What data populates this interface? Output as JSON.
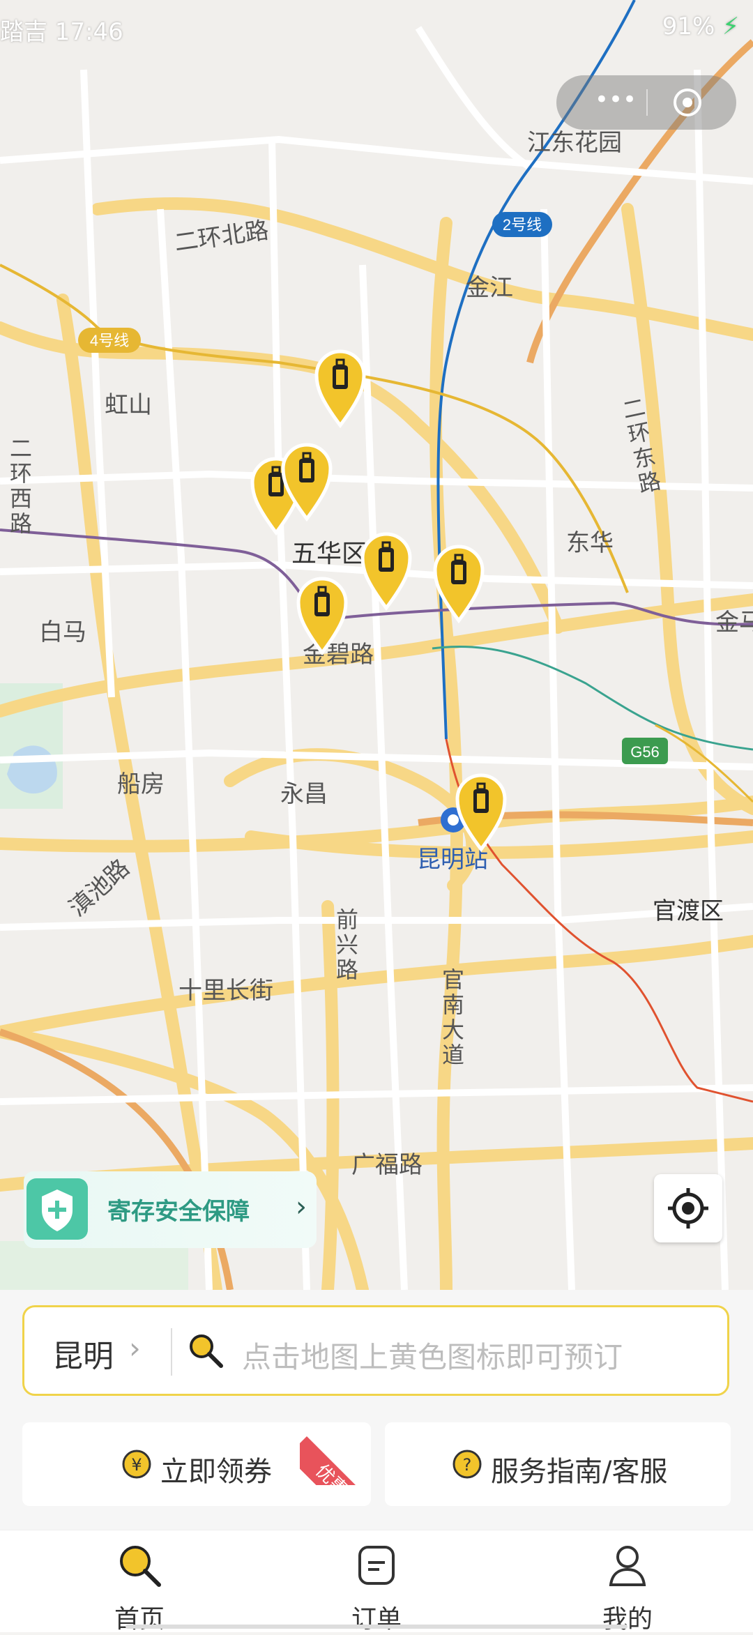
{
  "status_bar": {
    "left_text": "踏吉 17:46",
    "right_text": "91%"
  },
  "map": {
    "labels": [
      {
        "id": "jiangdong-huayuan",
        "text": "江东花园"
      },
      {
        "id": "line2",
        "text": "2号线"
      },
      {
        "id": "erhuan-beilu",
        "text": "二环北路"
      },
      {
        "id": "jinjiang",
        "text": "金江"
      },
      {
        "id": "line4",
        "text": "4号线"
      },
      {
        "id": "hongshan",
        "text": "虹山"
      },
      {
        "id": "erhuan-xilu",
        "text": "二环西路"
      },
      {
        "id": "erhuan-donglu",
        "text": "二环东路"
      },
      {
        "id": "wuhua-qu",
        "text": "五华区"
      },
      {
        "id": "donghua",
        "text": "东华"
      },
      {
        "id": "baima",
        "text": "白马"
      },
      {
        "id": "jinbi-lu",
        "text": "金碧路"
      },
      {
        "id": "chuanfang",
        "text": "船房"
      },
      {
        "id": "yongchang",
        "text": "永昌"
      },
      {
        "id": "kunming-zhan",
        "text": "昆明站"
      },
      {
        "id": "g56",
        "text": "G56"
      },
      {
        "id": "guandu-qu",
        "text": "官渡区"
      },
      {
        "id": "dianchi-lu",
        "text": "滇池路"
      },
      {
        "id": "qianxing-lu",
        "text": "前兴路"
      },
      {
        "id": "guannan-dadao",
        "text": "官南大道"
      },
      {
        "id": "shili-changjie",
        "text": "十里长街"
      },
      {
        "id": "guangfu-lu",
        "text": "广福路"
      },
      {
        "id": "jin-right",
        "text": "金马"
      }
    ],
    "pins_count": 7
  },
  "safe_banner": {
    "label": "寄存安全保障"
  },
  "search": {
    "city": "昆明",
    "placeholder": "点击地图上黄色图标即可预订"
  },
  "actions": {
    "coupon_label": "立即领券",
    "coupon_tag": "优惠",
    "guide_label": "服务指南/客服"
  },
  "tabbar": [
    {
      "label": "首页"
    },
    {
      "label": "订单"
    },
    {
      "label": "我的"
    }
  ],
  "colors": {
    "accent": "#f2c42b",
    "pin": "#f2c42b",
    "line2": "#1e6fc2",
    "line4": "#e6b733",
    "line_purple": "#7f5f98",
    "line_red": "#e0522f",
    "line_green": "#3aa38f"
  }
}
